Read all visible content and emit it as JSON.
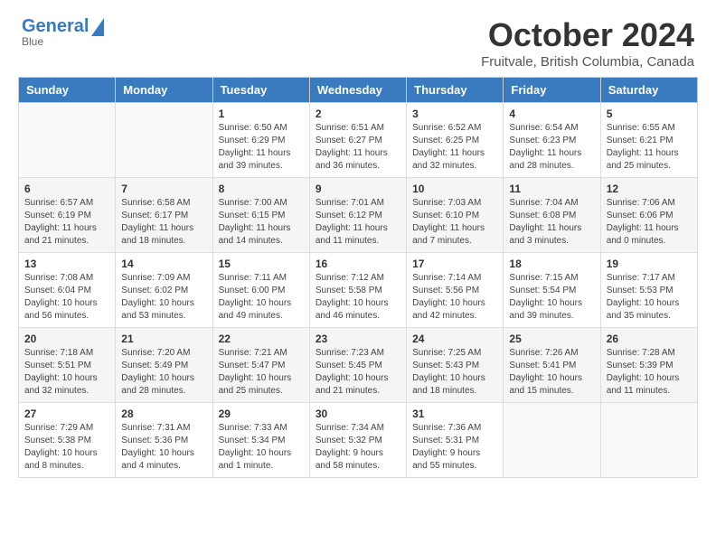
{
  "header": {
    "logo_line1": "General",
    "logo_line2": "Blue",
    "month": "October 2024",
    "location": "Fruitvale, British Columbia, Canada"
  },
  "weekdays": [
    "Sunday",
    "Monday",
    "Tuesday",
    "Wednesday",
    "Thursday",
    "Friday",
    "Saturday"
  ],
  "weeks": [
    [
      {
        "day": "",
        "info": ""
      },
      {
        "day": "",
        "info": ""
      },
      {
        "day": "1",
        "info": "Sunrise: 6:50 AM\nSunset: 6:29 PM\nDaylight: 11 hours and 39 minutes."
      },
      {
        "day": "2",
        "info": "Sunrise: 6:51 AM\nSunset: 6:27 PM\nDaylight: 11 hours and 36 minutes."
      },
      {
        "day": "3",
        "info": "Sunrise: 6:52 AM\nSunset: 6:25 PM\nDaylight: 11 hours and 32 minutes."
      },
      {
        "day": "4",
        "info": "Sunrise: 6:54 AM\nSunset: 6:23 PM\nDaylight: 11 hours and 28 minutes."
      },
      {
        "day": "5",
        "info": "Sunrise: 6:55 AM\nSunset: 6:21 PM\nDaylight: 11 hours and 25 minutes."
      }
    ],
    [
      {
        "day": "6",
        "info": "Sunrise: 6:57 AM\nSunset: 6:19 PM\nDaylight: 11 hours and 21 minutes."
      },
      {
        "day": "7",
        "info": "Sunrise: 6:58 AM\nSunset: 6:17 PM\nDaylight: 11 hours and 18 minutes."
      },
      {
        "day": "8",
        "info": "Sunrise: 7:00 AM\nSunset: 6:15 PM\nDaylight: 11 hours and 14 minutes."
      },
      {
        "day": "9",
        "info": "Sunrise: 7:01 AM\nSunset: 6:12 PM\nDaylight: 11 hours and 11 minutes."
      },
      {
        "day": "10",
        "info": "Sunrise: 7:03 AM\nSunset: 6:10 PM\nDaylight: 11 hours and 7 minutes."
      },
      {
        "day": "11",
        "info": "Sunrise: 7:04 AM\nSunset: 6:08 PM\nDaylight: 11 hours and 3 minutes."
      },
      {
        "day": "12",
        "info": "Sunrise: 7:06 AM\nSunset: 6:06 PM\nDaylight: 11 hours and 0 minutes."
      }
    ],
    [
      {
        "day": "13",
        "info": "Sunrise: 7:08 AM\nSunset: 6:04 PM\nDaylight: 10 hours and 56 minutes."
      },
      {
        "day": "14",
        "info": "Sunrise: 7:09 AM\nSunset: 6:02 PM\nDaylight: 10 hours and 53 minutes."
      },
      {
        "day": "15",
        "info": "Sunrise: 7:11 AM\nSunset: 6:00 PM\nDaylight: 10 hours and 49 minutes."
      },
      {
        "day": "16",
        "info": "Sunrise: 7:12 AM\nSunset: 5:58 PM\nDaylight: 10 hours and 46 minutes."
      },
      {
        "day": "17",
        "info": "Sunrise: 7:14 AM\nSunset: 5:56 PM\nDaylight: 10 hours and 42 minutes."
      },
      {
        "day": "18",
        "info": "Sunrise: 7:15 AM\nSunset: 5:54 PM\nDaylight: 10 hours and 39 minutes."
      },
      {
        "day": "19",
        "info": "Sunrise: 7:17 AM\nSunset: 5:53 PM\nDaylight: 10 hours and 35 minutes."
      }
    ],
    [
      {
        "day": "20",
        "info": "Sunrise: 7:18 AM\nSunset: 5:51 PM\nDaylight: 10 hours and 32 minutes."
      },
      {
        "day": "21",
        "info": "Sunrise: 7:20 AM\nSunset: 5:49 PM\nDaylight: 10 hours and 28 minutes."
      },
      {
        "day": "22",
        "info": "Sunrise: 7:21 AM\nSunset: 5:47 PM\nDaylight: 10 hours and 25 minutes."
      },
      {
        "day": "23",
        "info": "Sunrise: 7:23 AM\nSunset: 5:45 PM\nDaylight: 10 hours and 21 minutes."
      },
      {
        "day": "24",
        "info": "Sunrise: 7:25 AM\nSunset: 5:43 PM\nDaylight: 10 hours and 18 minutes."
      },
      {
        "day": "25",
        "info": "Sunrise: 7:26 AM\nSunset: 5:41 PM\nDaylight: 10 hours and 15 minutes."
      },
      {
        "day": "26",
        "info": "Sunrise: 7:28 AM\nSunset: 5:39 PM\nDaylight: 10 hours and 11 minutes."
      }
    ],
    [
      {
        "day": "27",
        "info": "Sunrise: 7:29 AM\nSunset: 5:38 PM\nDaylight: 10 hours and 8 minutes."
      },
      {
        "day": "28",
        "info": "Sunrise: 7:31 AM\nSunset: 5:36 PM\nDaylight: 10 hours and 4 minutes."
      },
      {
        "day": "29",
        "info": "Sunrise: 7:33 AM\nSunset: 5:34 PM\nDaylight: 10 hours and 1 minute."
      },
      {
        "day": "30",
        "info": "Sunrise: 7:34 AM\nSunset: 5:32 PM\nDaylight: 9 hours and 58 minutes."
      },
      {
        "day": "31",
        "info": "Sunrise: 7:36 AM\nSunset: 5:31 PM\nDaylight: 9 hours and 55 minutes."
      },
      {
        "day": "",
        "info": ""
      },
      {
        "day": "",
        "info": ""
      }
    ]
  ]
}
